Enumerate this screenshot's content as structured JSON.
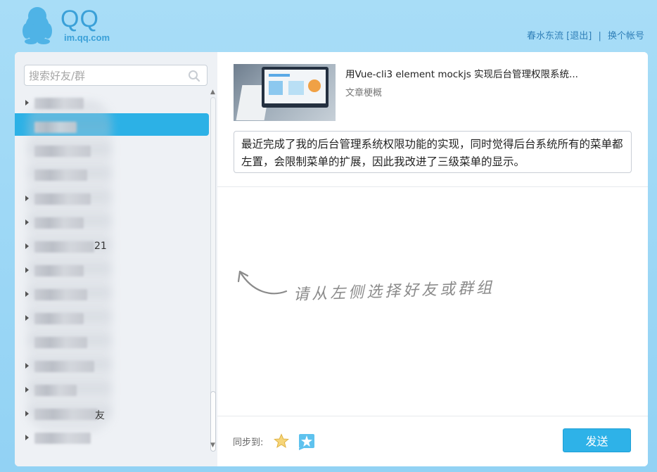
{
  "header": {
    "logo_text": "QQ",
    "logo_subtext": "im.qq.com",
    "username": "春水东流",
    "logout": "[退出]",
    "separator": "|",
    "switch_account": "换个帐号"
  },
  "sidebar": {
    "search_placeholder": "搜索好友/群",
    "groups": [
      {
        "label": ""
      },
      {
        "label": ""
      },
      {
        "label": ""
      },
      {
        "label": ""
      },
      {
        "label": ""
      },
      {
        "label": ""
      },
      {
        "label": "21"
      },
      {
        "label": ""
      },
      {
        "label": ""
      },
      {
        "label": ""
      },
      {
        "label": ""
      },
      {
        "label": ""
      },
      {
        "label": ""
      },
      {
        "label": "友"
      },
      {
        "label": ""
      }
    ]
  },
  "share": {
    "title": "用Vue-cli3 element mockjs 实现后台管理权限系统...",
    "subtitle": "文章梗概",
    "description": "最近完成了我的后台管理系统权限功能的实现，同时觉得后台系统所有的菜单都左置，会限制菜单的扩展，因此我改进了三级菜单的显示。"
  },
  "hint": {
    "text": "请从左侧选择好友或群组"
  },
  "footer": {
    "sync_label": "同步到:",
    "send_label": "发送"
  },
  "colors": {
    "background": "#a8ddf7",
    "accent": "#2cb1e6",
    "link": "#2f7fb8"
  }
}
